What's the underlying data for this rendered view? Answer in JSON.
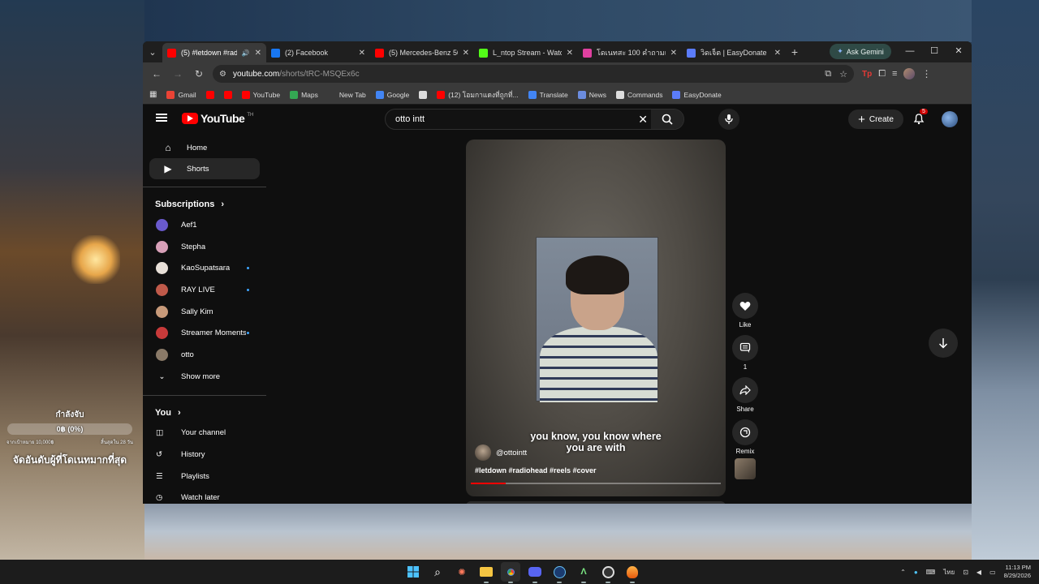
{
  "overlay": {
    "title": "กำลังจับ",
    "amount": "0฿ (0%)",
    "goal_left": "จากเป้าหมาย 10,000฿",
    "goal_right": "สิ้นสุดใน 28 วัน",
    "ranking": "จัดอันดับผู้ที่โดเนทมากที่สุด"
  },
  "browser": {
    "tabs": [
      {
        "label": "(5) #letdown #radiohead",
        "favicon": "youtube-icon",
        "color": "#ff0000",
        "active": true,
        "audio": true
      },
      {
        "label": "(2) Facebook",
        "favicon": "facebook-icon",
        "color": "#1877f2",
        "active": false
      },
      {
        "label": "(5) Mercedes-Benz 500",
        "favicon": "youtube-icon",
        "color": "#ff0000",
        "active": false
      },
      {
        "label": "L_ntop Stream - Watch",
        "favicon": "kick-icon",
        "color": "#53fc18",
        "active": false
      },
      {
        "label": "โดเนทสะ 100 คำถามเด็ด",
        "favicon": "donate-icon",
        "color": "#e040a0",
        "active": false
      },
      {
        "label": "วิดเจ็ต | EasyDonate",
        "favicon": "easydonate-icon",
        "color": "#5b7cfa",
        "active": false
      }
    ],
    "gemini_label": "Ask Gemini",
    "url_host": "youtube.com",
    "url_path": "/shorts/tRC-MSQEx6c",
    "bookmarks": [
      {
        "label": "Gmail",
        "color": "#ea4335"
      },
      {
        "label": "",
        "color": "#ff0000"
      },
      {
        "label": "",
        "color": "#ff0000"
      },
      {
        "label": "YouTube",
        "color": "#ff0000"
      },
      {
        "label": "Maps",
        "color": "#34a853"
      },
      {
        "label": "New Tab",
        "color": "#3a3a3a"
      },
      {
        "label": "Google",
        "color": "#4285f4"
      },
      {
        "label": "",
        "color": "#dddddd"
      },
      {
        "label": "(12) โอมกาแดงที่ถูกที่...",
        "color": "#ff0000"
      },
      {
        "label": "Translate",
        "color": "#4285f4"
      },
      {
        "label": "News",
        "color": "#6b8cdf"
      },
      {
        "label": "Commands",
        "color": "#dddddd"
      },
      {
        "label": "EasyDonate",
        "color": "#5b7cfa"
      }
    ]
  },
  "youtube": {
    "logo_text": "YouTube",
    "logo_country": "TH",
    "search_value": "otto intt",
    "create_label": "Create",
    "notifications": "5",
    "nav": [
      {
        "label": "Home",
        "icon": "home-icon"
      },
      {
        "label": "Shorts",
        "icon": "shorts-icon",
        "active": true
      }
    ],
    "subscriptions_heading": "Subscriptions",
    "subscriptions": [
      {
        "name": "Aef1",
        "color": "#6a5acd",
        "live": false
      },
      {
        "name": "Stepha",
        "color": "#d8a0b8",
        "live": false
      },
      {
        "name": "KaoSupatsara",
        "color": "#e8e0d8",
        "live": true
      },
      {
        "name": "RAY LIVE",
        "color": "#c05a4a",
        "live": true
      },
      {
        "name": "Sally Kim",
        "color": "#c89a7a",
        "live": false
      },
      {
        "name": "Streamer Moments",
        "color": "#c83a3a",
        "live": true
      },
      {
        "name": "otto",
        "color": "#8a7a68",
        "live": false
      }
    ],
    "show_more": "Show more",
    "you_heading": "You",
    "you_items": [
      {
        "label": "Your channel",
        "icon": "channel-icon"
      },
      {
        "label": "History",
        "icon": "history-icon"
      },
      {
        "label": "Playlists",
        "icon": "playlists-icon"
      },
      {
        "label": "Watch later",
        "icon": "watch-later-icon"
      }
    ],
    "short": {
      "caption_line1": "you know, you know where",
      "caption_line2": "you are with",
      "channel": "@ottointt",
      "hashtags": "#letdown #radiohead #reels #cover",
      "progress": 0.14
    },
    "actions": {
      "like": "Like",
      "comments": "1",
      "share": "Share",
      "remix": "Remix"
    }
  },
  "taskbar": {
    "language": "ไทย",
    "time": "11:13 PM",
    "date": "8/29/2026"
  }
}
